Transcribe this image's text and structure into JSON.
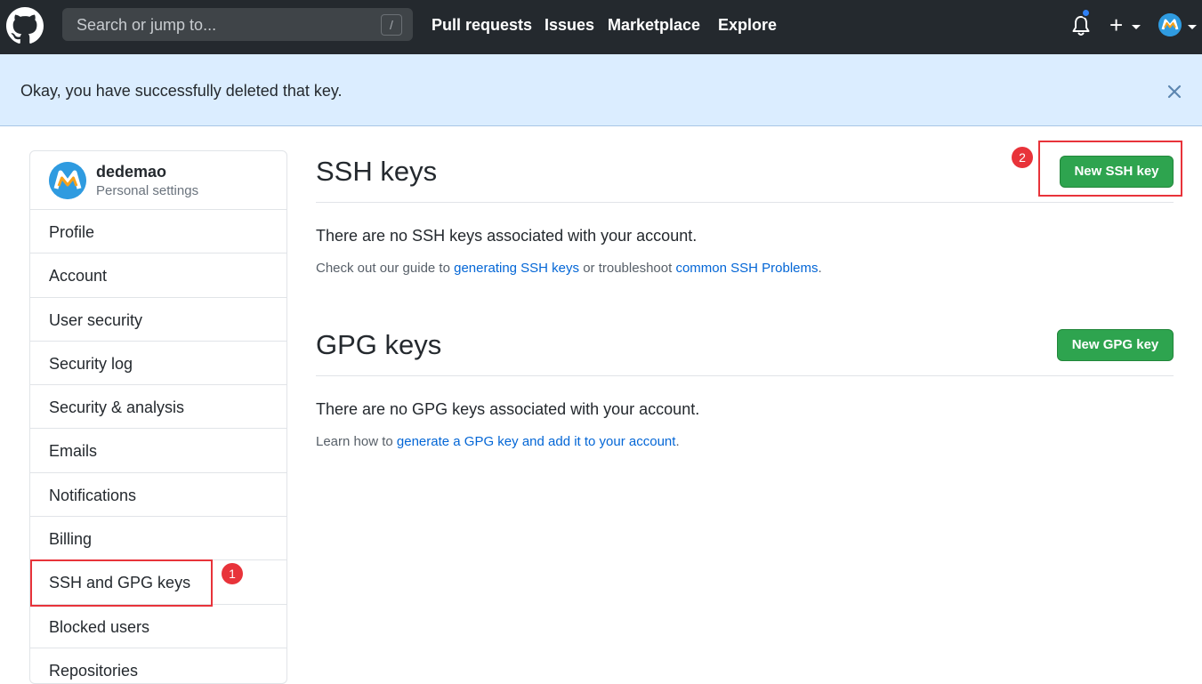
{
  "header": {
    "search_placeholder": "Search or jump to...",
    "search_shortcut": "/",
    "nav": [
      "Pull requests",
      "Issues",
      "Marketplace",
      "Explore"
    ],
    "plus_symbol": "+"
  },
  "flash": {
    "message": "Okay, you have successfully deleted that key."
  },
  "sidebar": {
    "username": "dedemao",
    "subtitle": "Personal settings",
    "items": [
      "Profile",
      "Account",
      "User security",
      "Security log",
      "Security & analysis",
      "Emails",
      "Notifications",
      "Billing",
      "SSH and GPG keys",
      "Blocked users",
      "Repositories"
    ]
  },
  "ssh": {
    "title": "SSH keys",
    "button": "New SSH key",
    "empty": "There are no SSH keys associated with your account.",
    "guide_prefix": "Check out our guide to ",
    "guide_link1": "generating SSH keys",
    "guide_middle": " or troubleshoot ",
    "guide_link2": "common SSH Problems",
    "guide_suffix": "."
  },
  "gpg": {
    "title": "GPG keys",
    "button": "New GPG key",
    "empty": "There are no GPG keys associated with your account.",
    "learn_prefix": "Learn how to ",
    "learn_link": "generate a GPG key and add it to your account",
    "learn_suffix": "."
  },
  "annotations": {
    "badge1": "1",
    "badge2": "2"
  },
  "colors": {
    "header_bg": "#24292e",
    "flash_bg": "#dbedff",
    "button_green": "#2ea44f",
    "link_blue": "#0366d6",
    "annotation_red": "#e8333a"
  }
}
